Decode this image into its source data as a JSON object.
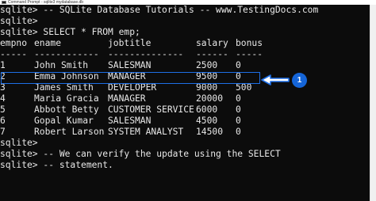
{
  "window": {
    "title": "Command Prompt - sqlite3 mydatabase.db"
  },
  "terminal": {
    "lines_before": [
      "sqlite> -- SQLite Database Tutorials -- www.TestingDocs.com",
      "sqlite>",
      "sqlite> SELECT * FROM emp;"
    ],
    "table": {
      "headers": [
        "empno",
        "ename",
        "jobtitle",
        "salary",
        "bonus"
      ],
      "separators": [
        "-----",
        "------------",
        "--------------",
        "------",
        "-----"
      ],
      "rows": [
        [
          "1",
          "John Smith",
          "SALESMAN",
          "2500",
          "0"
        ],
        [
          "2",
          "Emma Johnson",
          "MANAGER",
          "9500",
          "0"
        ],
        [
          "3",
          "James Smith",
          "DEVELOPER",
          "9000",
          "500"
        ],
        [
          "4",
          "Maria Gracia",
          "MANAGER",
          "20000",
          "0"
        ],
        [
          "5",
          "Abbott Betty",
          "CUSTOMER SERVICE",
          "6000",
          "0"
        ],
        [
          "6",
          "Gopal Kumar",
          "SALESMAN",
          "4500",
          "0"
        ],
        [
          "7",
          "Robert Larson",
          "SYSTEM ANALYST",
          "14500",
          "0"
        ]
      ]
    },
    "lines_after": [
      "sqlite>",
      "sqlite> -- We can verify the update using the SELECT",
      "sqlite> -- statement."
    ]
  },
  "annotation": {
    "badge_label": "1",
    "color": "#1e6fe6"
  }
}
